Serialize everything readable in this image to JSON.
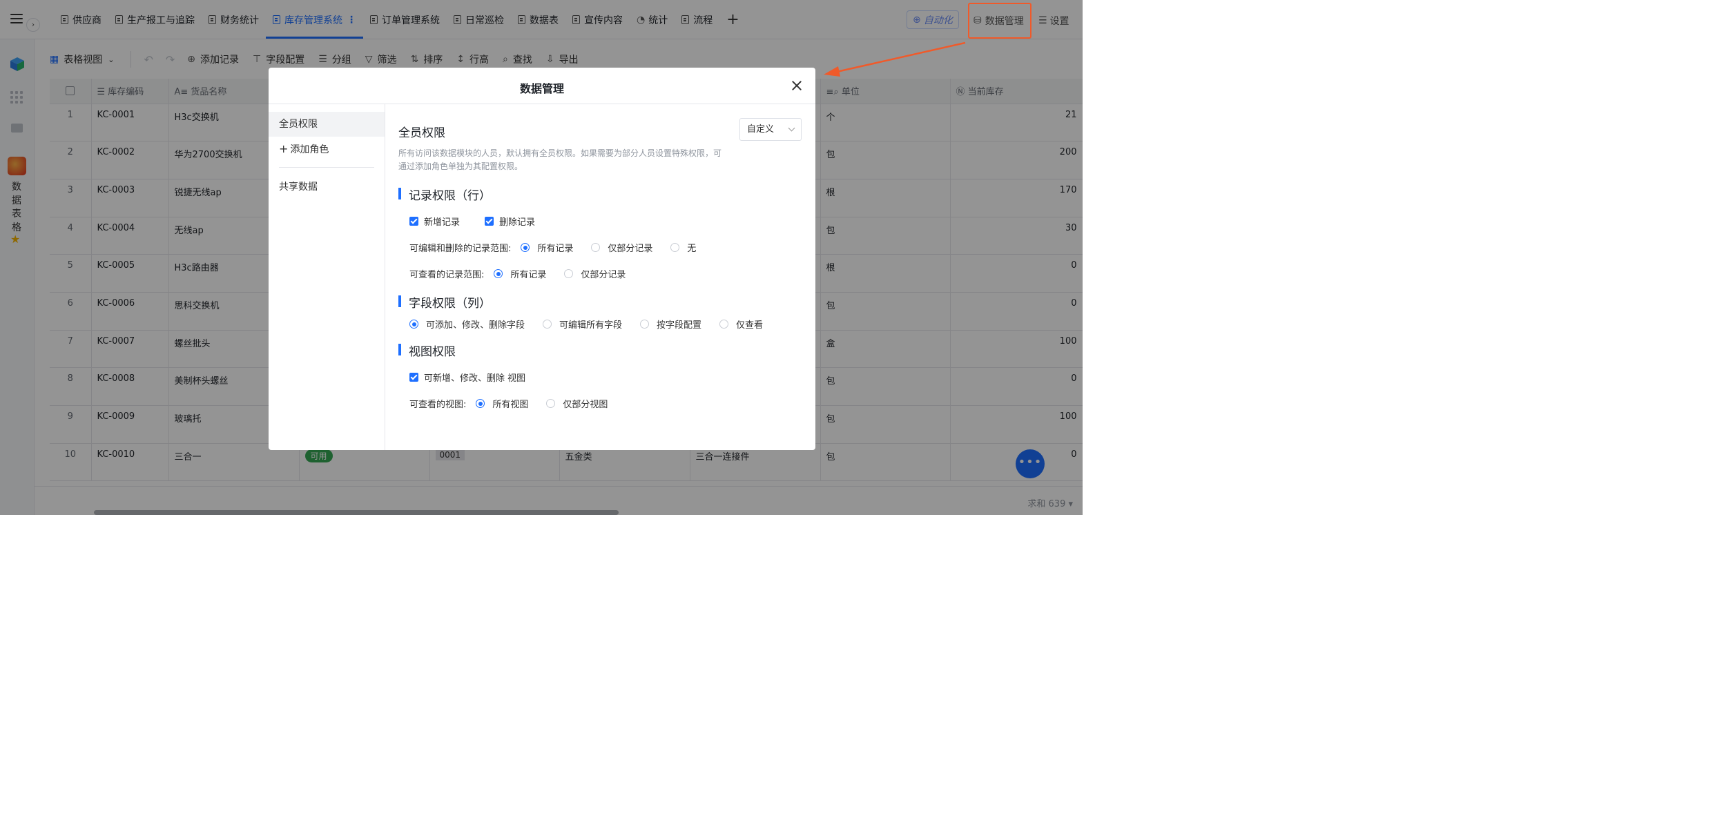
{
  "topbar": {
    "tabs": [
      {
        "label": "供应商"
      },
      {
        "label": "生产报工与追踪"
      },
      {
        "label": "财务统计"
      },
      {
        "label": "库存管理系统",
        "active": true
      },
      {
        "label": "订单管理系统"
      },
      {
        "label": "日常巡检"
      },
      {
        "label": "数据表"
      },
      {
        "label": "宣传内容"
      },
      {
        "label": "统计"
      },
      {
        "label": "流程"
      }
    ],
    "more_glyph": "⋮",
    "add_tab_glyph": "+",
    "automation_label": "自动化",
    "data_management_label": "数据管理",
    "settings_label": "设置"
  },
  "leftbar": {
    "app_name": "数据表格"
  },
  "toolbar": {
    "view_label": "表格视图",
    "add_record": "添加记录",
    "field_config": "字段配置",
    "group": "分组",
    "filter": "筛选",
    "sort": "排序",
    "row_height": "行高",
    "find": "查找",
    "export": "导出"
  },
  "table": {
    "headers": [
      "库存编码",
      "货品名称",
      "单位",
      "当前库存"
    ],
    "rows": [
      {
        "no": "1",
        "code": "KC-0001",
        "name": "H3c交换机",
        "unit": "个",
        "stock": "21"
      },
      {
        "no": "2",
        "code": "KC-0002",
        "name": "华为2700交换机",
        "unit": "包",
        "stock": "200"
      },
      {
        "no": "3",
        "code": "KC-0003",
        "name": "锐捷无线ap",
        "unit": "根",
        "stock": "170"
      },
      {
        "no": "4",
        "code": "KC-0004",
        "name": "无线ap",
        "unit": "包",
        "stock": "30"
      },
      {
        "no": "5",
        "code": "KC-0005",
        "name": "H3c路由器",
        "unit": "根",
        "stock": "0"
      },
      {
        "no": "6",
        "code": "KC-0006",
        "name": "思科交换机",
        "unit": "包",
        "stock": "0"
      },
      {
        "no": "7",
        "code": "KC-0007",
        "name": "螺丝批头",
        "unit": "盒",
        "stock": "100"
      },
      {
        "no": "8",
        "code": "KC-0008",
        "name": "美制杯头螺丝",
        "unit": "包",
        "stock": "0"
      },
      {
        "no": "9",
        "code": "KC-0009",
        "name": "玻璃托",
        "unit": "包",
        "stock": "100"
      },
      {
        "no": "10",
        "code": "KC-0010",
        "name": "三合一",
        "status": "可用",
        "tag": "0001",
        "category": "五金类",
        "desc": "三合一连接件",
        "unit": "包",
        "stock": "0"
      }
    ],
    "footer_sum": "求和 639 ▾"
  },
  "fab_glyph": "•••",
  "modal": {
    "title": "数据管理",
    "sidebar": {
      "all_members": "全员权限",
      "add_role": "添加角色",
      "add_role_glyph": "+",
      "shared_data": "共享数据"
    },
    "section_title": "全员权限",
    "mode_select": "自定义",
    "description": "所有访问该数据模块的人员，默认拥有全员权限。如果需要为部分人员设置特殊权限，可通过添加角色单独为其配置权限。",
    "record_perm": {
      "title": "记录权限（行）",
      "add_record": "新增记录",
      "delete_record": "删除记录",
      "edit_scope_label": "可编辑和删除的记录范围:",
      "edit_scope_options": [
        "所有记录",
        "仅部分记录",
        "无"
      ],
      "view_scope_label": "可查看的记录范围:",
      "view_scope_options": [
        "所有记录",
        "仅部分记录"
      ]
    },
    "field_perm": {
      "title": "字段权限（列）",
      "options": [
        "可添加、修改、删除字段",
        "可编辑所有字段",
        "按字段配置",
        "仅查看"
      ]
    },
    "view_perm": {
      "title": "视图权限",
      "can_edit_views": "可新增、修改、删除 视图",
      "visible_label": "可查看的视图:",
      "visible_options": [
        "所有视图",
        "仅部分视图"
      ]
    }
  },
  "colors": {
    "accent": "#1e6fff",
    "annotation": "#f05a2a",
    "status_green": "#34a853"
  }
}
